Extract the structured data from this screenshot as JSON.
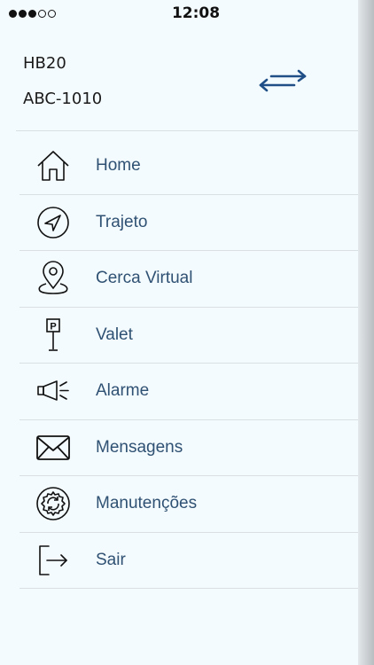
{
  "status_bar": {
    "time": "12:08",
    "signal_bars_filled": 3,
    "signal_bars_total": 5
  },
  "header": {
    "model": "HB20",
    "plate": "ABC-1010",
    "swap_icon": "swap-arrows-icon"
  },
  "menu": {
    "items": [
      {
        "label": "Home",
        "icon": "home-icon"
      },
      {
        "label": "Trajeto",
        "icon": "navigation-arrow-icon"
      },
      {
        "label": "Cerca Virtual",
        "icon": "map-pin-icon"
      },
      {
        "label": "Valet",
        "icon": "parking-sign-icon"
      },
      {
        "label": "Alarme",
        "icon": "megaphone-icon"
      },
      {
        "label": "Mensagens",
        "icon": "envelope-icon"
      },
      {
        "label": "Manutenções",
        "icon": "gear-icon"
      },
      {
        "label": "Sair",
        "icon": "logout-icon"
      }
    ]
  },
  "colors": {
    "background": "#f4fbfe",
    "label_text": "#2f5173",
    "accent_arrow": "#1f4f86",
    "divider": "#d9dfe3"
  }
}
